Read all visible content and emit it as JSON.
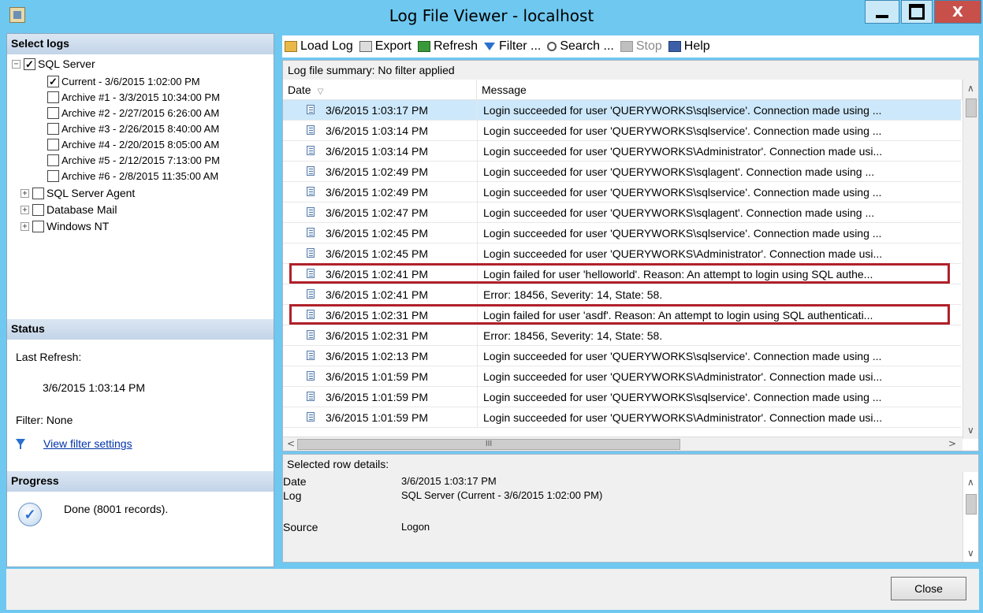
{
  "window": {
    "title": "Log File Viewer - localhost",
    "close_glyph": "X"
  },
  "left": {
    "select_logs_title": "Select logs",
    "tree": [
      {
        "label": "SQL Server",
        "expander": "−",
        "checked": true,
        "level": 0
      },
      {
        "label": "Current - 3/6/2015 1:02:00 PM",
        "checked": true,
        "level": 1
      },
      {
        "label": "Archive #1 - 3/3/2015 10:34:00 PM",
        "checked": false,
        "level": 1
      },
      {
        "label": "Archive #2 - 2/27/2015 6:26:00 AM",
        "checked": false,
        "level": 1
      },
      {
        "label": "Archive #3 - 2/26/2015 8:40:00 AM",
        "checked": false,
        "level": 1
      },
      {
        "label": "Archive #4 - 2/20/2015 8:05:00 AM",
        "checked": false,
        "level": 1
      },
      {
        "label": "Archive #5 - 2/12/2015 7:13:00 PM",
        "checked": false,
        "level": 1
      },
      {
        "label": "Archive #6 - 2/8/2015 11:35:00 AM",
        "checked": false,
        "level": 1
      },
      {
        "label": "SQL Server Agent",
        "expander": "+",
        "checked": false,
        "level": 0
      },
      {
        "label": "Database Mail",
        "expander": "+",
        "checked": false,
        "level": 0
      },
      {
        "label": "Windows NT",
        "expander": "+",
        "checked": false,
        "level": 0
      }
    ],
    "status_title": "Status",
    "last_refresh_label": "Last Refresh:",
    "last_refresh_value": "3/6/2015 1:03:14 PM",
    "filter_label": "Filter: None",
    "view_filter_link": "View filter settings",
    "progress_title": "Progress",
    "progress_text": "Done (8001 records)."
  },
  "toolbar": {
    "load_log": "Load Log",
    "export": "Export",
    "refresh": "Refresh",
    "filter": "Filter ...",
    "search": "Search ...",
    "stop": "Stop",
    "help": "Help"
  },
  "grid": {
    "summary": "Log file summary: No filter applied",
    "col_date": "Date",
    "col_message": "Message",
    "rows": [
      {
        "date": "3/6/2015 1:03:17 PM",
        "message": "Login succeeded for user 'QUERYWORKS\\sqlservice'. Connection made using ...",
        "selected": true
      },
      {
        "date": "3/6/2015 1:03:14 PM",
        "message": "Login succeeded for user 'QUERYWORKS\\sqlservice'. Connection made using ..."
      },
      {
        "date": "3/6/2015 1:03:14 PM",
        "message": "Login succeeded for user 'QUERYWORKS\\Administrator'. Connection made usi..."
      },
      {
        "date": "3/6/2015 1:02:49 PM",
        "message": "Login succeeded for user 'QUERYWORKS\\sqlagent'. Connection made using ..."
      },
      {
        "date": "3/6/2015 1:02:49 PM",
        "message": "Login succeeded for user 'QUERYWORKS\\sqlservice'. Connection made using ..."
      },
      {
        "date": "3/6/2015 1:02:47 PM",
        "message": "Login succeeded for user 'QUERYWORKS\\sqlagent'. Connection made using ..."
      },
      {
        "date": "3/6/2015 1:02:45 PM",
        "message": "Login succeeded for user 'QUERYWORKS\\sqlservice'. Connection made using ..."
      },
      {
        "date": "3/6/2015 1:02:45 PM",
        "message": "Login succeeded for user 'QUERYWORKS\\Administrator'. Connection made usi..."
      },
      {
        "date": "3/6/2015 1:02:41 PM",
        "message": "Login failed for user 'helloworld'. Reason: An attempt to login using SQL authe...",
        "highlighted": true
      },
      {
        "date": "3/6/2015 1:02:41 PM",
        "message": "Error: 18456, Severity: 14, State: 58."
      },
      {
        "date": "3/6/2015 1:02:31 PM",
        "message": "Login failed for user 'asdf'. Reason: An attempt to login using SQL authenticati...",
        "highlighted": true
      },
      {
        "date": "3/6/2015 1:02:31 PM",
        "message": "Error: 18456, Severity: 14, State: 58."
      },
      {
        "date": "3/6/2015 1:02:13 PM",
        "message": "Login succeeded for user 'QUERYWORKS\\sqlservice'. Connection made using ..."
      },
      {
        "date": "3/6/2015 1:01:59 PM",
        "message": "Login succeeded for user 'QUERYWORKS\\Administrator'. Connection made usi..."
      },
      {
        "date": "3/6/2015 1:01:59 PM",
        "message": "Login succeeded for user 'QUERYWORKS\\sqlservice'. Connection made using ..."
      },
      {
        "date": "3/6/2015 1:01:59 PM",
        "message": "Login succeeded for user 'QUERYWORKS\\Administrator'. Connection made usi..."
      }
    ],
    "hscroll_thumb": "III"
  },
  "details": {
    "title": "Selected row details:",
    "date_label": "Date",
    "date_value": "3/6/2015 1:03:17 PM",
    "log_label": "Log",
    "log_value": "SQL Server (Current - 3/6/2015 1:02:00 PM)",
    "source_label": "Source",
    "source_value": "Logon"
  },
  "close_button": "Close",
  "colors": {
    "title_bar": "#6fc8f0",
    "selected_row": "#cde8fb",
    "highlight_border": "#b0202a",
    "link": "#0033aa"
  }
}
